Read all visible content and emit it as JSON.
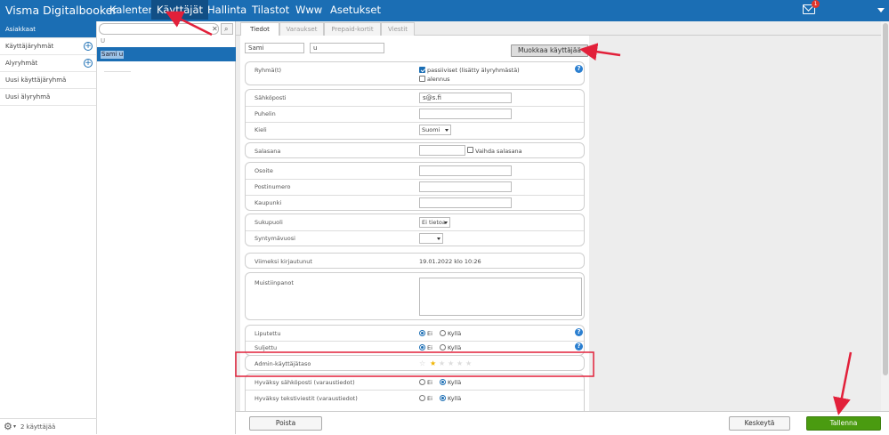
{
  "topbar": {
    "brand": "Visma Digitalbooker",
    "nav": [
      "Kalenteri",
      "Käyttäjät",
      "Hallinta",
      "Tilastot",
      "Www",
      "Asetukset"
    ],
    "active_nav": "Käyttäjät",
    "mail_badge": "1"
  },
  "sidebar": {
    "items": [
      {
        "label": "Asiakkaat",
        "active": true,
        "plus": false
      },
      {
        "label": "Käyttäjäryhmät",
        "active": false,
        "plus": true
      },
      {
        "label": "Alyryhmät",
        "active": false,
        "plus": true
      },
      {
        "label": "Uusi käyttäjäryhmä",
        "active": false,
        "plus": false
      },
      {
        "label": "Uusi älyryhmä",
        "active": false,
        "plus": false
      }
    ],
    "footer_count": "2 käyttäjää"
  },
  "list": {
    "search_value": "",
    "group_letter": "U",
    "selected_user": "Sami u"
  },
  "tabs": [
    "Tiedot",
    "Varaukset",
    "Prepaid-kortit",
    "Viestit"
  ],
  "form": {
    "first_name": "Sami",
    "last_name": "u",
    "edit_button": "Muokkaa käyttäjää",
    "groups_label": "Ryhmä(t)",
    "group_options": [
      {
        "label": "passiiviset (lisätty älyryhmästä)",
        "checked": true
      },
      {
        "label": "alennus",
        "checked": false
      }
    ],
    "email_label": "Sähköposti",
    "email_value": "s@s.fi",
    "phone_label": "Puhelin",
    "phone_value": "",
    "language_label": "Kieli",
    "language_value": "Suomi",
    "password_label": "Salasana",
    "change_password_label": "Vaihda salasana",
    "address_label": "Osoite",
    "postal_label": "Postinumero",
    "city_label": "Kaupunki",
    "gender_label": "Sukupuoli",
    "gender_value": "Ei tietoa",
    "birth_year_label": "Syntymävuosi",
    "birth_year_value": "",
    "last_login_label": "Viimeksi kirjautunut",
    "last_login_value": "19.01.2022 klo 10:26",
    "notes_label": "Muistiinpanot",
    "flagged_label": "Liputettu",
    "blocked_label": "Suljettu",
    "no_label": "Ei",
    "yes_label": "Kyllä",
    "flagged_value": "Ei",
    "blocked_value": "Ei",
    "admin_level_label": "Admin-käyttäjätaso",
    "admin_level": 1,
    "admin_level_max": 5,
    "accept_email_label": "Hyväksy sähköposti (varaustiedot)",
    "accept_email_value": "Kyllä",
    "accept_sms_label": "Hyväksy tekstiviestit (varaustiedot)",
    "accept_sms_value": "Kyllä"
  },
  "footer": {
    "delete_button": "Poista",
    "cancel_button": "Keskeytä",
    "save_button": "Tallenna"
  },
  "colors": {
    "topbar": "#1b6eb4",
    "save_button": "#4a9b10",
    "annotation": "#e2203a"
  }
}
